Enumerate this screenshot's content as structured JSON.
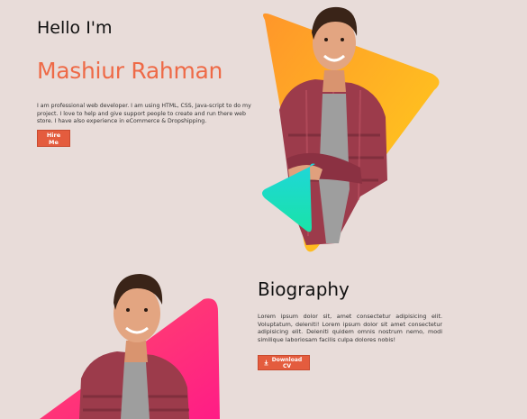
{
  "hero": {
    "greeting": "Hello I'm",
    "name": "Mashiur Rahman",
    "intro": "I am professional web developer. I am using HTML, CSS, Java-script to do my project. I love to help and give support people to create and run there web store. I have also experience in eCommerce & Dropshipping.",
    "hire_label": "Hire Me"
  },
  "biography": {
    "title": "Biography",
    "text": "Lorem ipsum dolor sit, amet consectetur adipisicing elit. Voluptatum, deleniti! Lorem ipsum dolor sit amet consectetur adipisicing elit. Deleniti quidem omnis nostrum nemo, modi similique laboriosam facilis culpa dolores nobis!",
    "download_label": "Download CV",
    "download_icon": "download-icon"
  },
  "colors": {
    "background": "#e8dcd9",
    "accent": "#ee6a47",
    "button": "#e45c3e",
    "hero_gradient": [
      "#ff9a2a",
      "#ffd11a"
    ],
    "small_triangle_gradient": [
      "#18e3c3",
      "#1e8cf0"
    ],
    "bio_gradient": [
      "#ff3d6e",
      "#ff1f82"
    ]
  }
}
